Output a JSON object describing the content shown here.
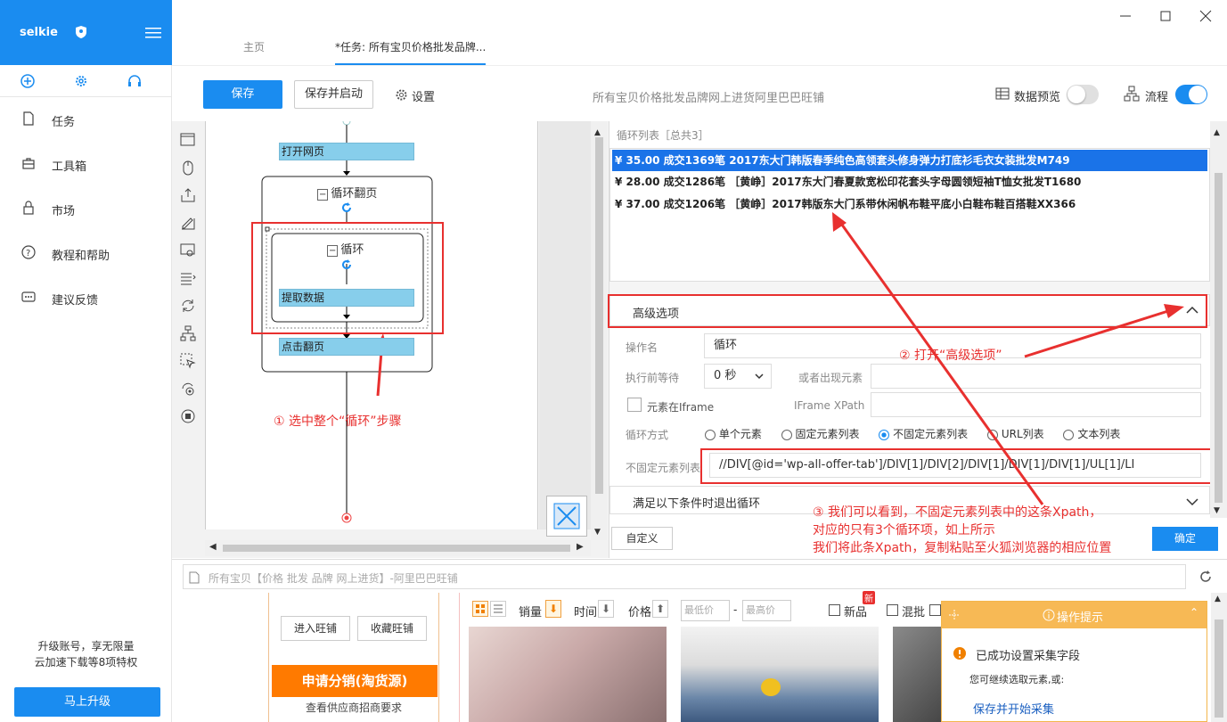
{
  "app": {
    "brand": "selkie"
  },
  "tabs": [
    {
      "label": "主页"
    },
    {
      "label": "*任务: 所有宝贝价格批发品牌..."
    }
  ],
  "nav": [
    {
      "label": "任务",
      "icon": "file-icon"
    },
    {
      "label": "工具箱",
      "icon": "toolbox-icon"
    },
    {
      "label": "市场",
      "icon": "lock-icon"
    },
    {
      "label": "教程和帮助",
      "icon": "help-icon"
    },
    {
      "label": "建议反馈",
      "icon": "chat-icon"
    }
  ],
  "upgrade": {
    "line1": "升级账号，享无限量",
    "line2": "云加速下载等8项特权",
    "button": "马上升级"
  },
  "toolbar": {
    "save": "保存",
    "save_start": "保存并启动",
    "settings": "设置",
    "task_title": "所有宝贝价格批发品牌网上进货阿里巴巴旺铺",
    "data_preview": "数据预览",
    "flow": "流程"
  },
  "flow": {
    "open_page": "打开网页",
    "loop_page": "循环翻页",
    "loop": "循环",
    "extract": "提取数据",
    "click_next": "点击翻页"
  },
  "annotations": {
    "a1": "① 选中整个“循环”步骤",
    "a2": "② 打开“高级选项”",
    "a3_1": "③ 我们可以看到，不固定元素列表中的这条Xpath，",
    "a3_2": "对应的只有3个循环项，如上所示",
    "a3_3": "我们将此条Xpath，复制粘贴至火狐浏览器的相应位置"
  },
  "looplist": {
    "header": "循环列表［总共3］",
    "rows": [
      "¥ 35.00 成交1369笔  2017东大门韩版春季纯色高领套头修身弹力打底衫毛衣女装批发M749",
      "¥ 28.00 成交1286笔 ［黄峥］2017东大门春夏款宽松印花套头字母圆领短袖T恤女批发T1680",
      "¥ 37.00 成交1206笔 ［黄峥］2017韩版东大门系带休闲帆布鞋平底小白鞋布鞋百搭鞋XX366"
    ]
  },
  "advanced": {
    "title": "高级选项",
    "op_name_label": "操作名",
    "op_name": "循环",
    "wait_label": "执行前等待",
    "wait_value": "0 秒",
    "or_appear_label": "或者出现元素",
    "iframe_label": "元素在Iframe",
    "iframe_xpath_label": "IFrame XPath",
    "loop_mode_label": "循环方式",
    "modes": [
      "单个元素",
      "固定元素列表",
      "不固定元素列表",
      "URL列表",
      "文本列表"
    ],
    "selected_mode": "不固定元素列表",
    "list_label": "不固定元素列表",
    "xpath": "//DIV[@id='wp-all-offer-tab']/DIV[1]/DIV[2]/DIV[1]/DIV[1]/DIV[1]/UL[1]/LI",
    "exit_cond": "满足以下条件时退出循环",
    "custom": "自定义",
    "confirm": "确定"
  },
  "browser": {
    "url": "所有宝贝【价格 批发 品牌 网上进货】-阿里巴巴旺铺",
    "enter_shop": "进入旺铺",
    "fav_shop": "收藏旺铺",
    "apply": "申请分销(淘货源)",
    "supplier": "查看供应商招商要求",
    "sales": "销量",
    "time": "时间",
    "price": "价格",
    "low_price": "最低价",
    "high_price": "最高价",
    "new": "新品",
    "new_badge": "新",
    "mixed": "混批",
    "tip_title": "操作提示",
    "tip_success": "已成功设置采集字段",
    "tip_continue": "您可继续选取元素,或:",
    "tip_link": "保存并开始采集"
  },
  "colors": {
    "primary": "#1a8cf0",
    "annotation": "#e8302f",
    "flowbox": "#87ceeb",
    "orange": "#ff7a00"
  }
}
